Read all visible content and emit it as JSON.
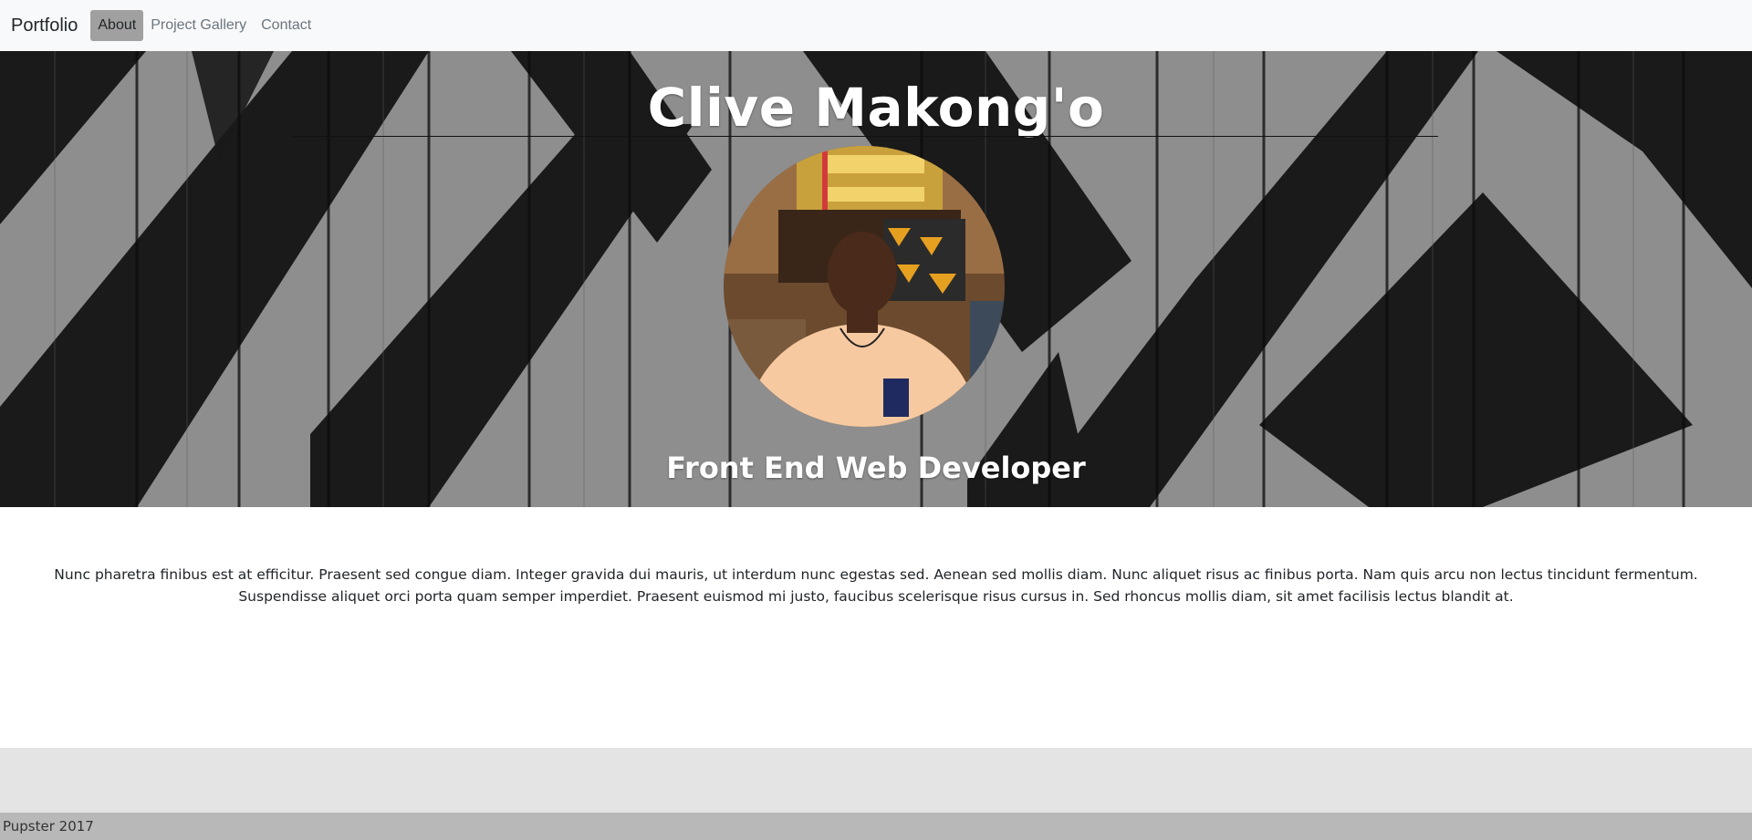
{
  "nav": {
    "brand": "Portfolio",
    "links": [
      "About",
      "Project Gallery",
      "Contact"
    ],
    "active": "About"
  },
  "hero": {
    "name": "Clive Makong'o",
    "subtitle": "Front End Web Developer"
  },
  "about": {
    "text": "Nunc pharetra finibus est at efficitur. Praesent sed congue diam. Integer gravida dui mauris, ut interdum nunc egestas sed. Aenean sed mollis diam. Nunc aliquet risus ac finibus porta. Nam quis arcu non lectus tincidunt fermentum. Suspendisse aliquet orci porta quam semper imperdiet. Praesent euismod mi justo, faucibus scelerisque risus cursus in. Sed rhoncus mollis diam, sit amet facilisis lectus blandit at."
  },
  "footer": {
    "text": "Pupster 2017"
  },
  "colors": {
    "navbar_bg": "#f8f9fa",
    "active_link_bg": "#a0a0a0",
    "footer_band": "#e4e4e4",
    "footer_bar": "#b8b8b8"
  }
}
